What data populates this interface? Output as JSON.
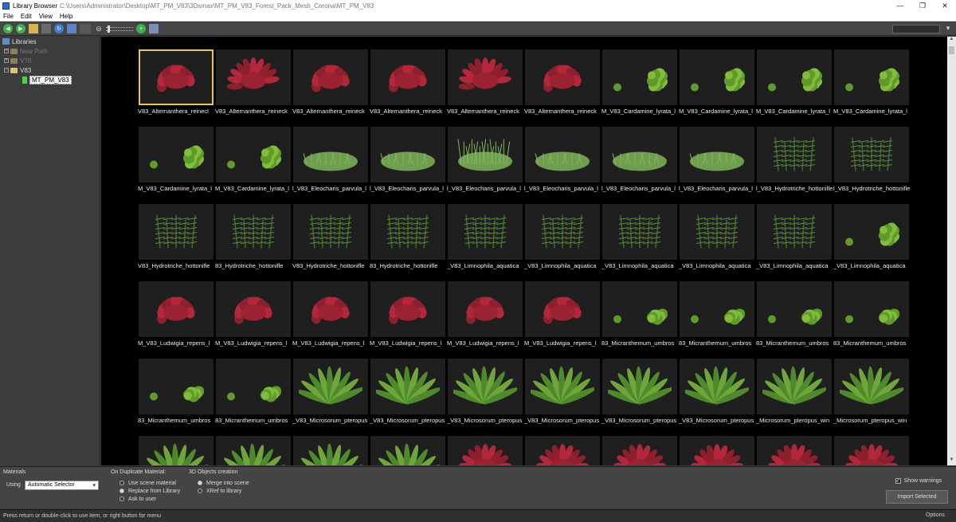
{
  "window": {
    "title": "Library Browser",
    "path": "C:\\Users\\Administrator\\Desktop\\MT_PM_V83\\3Dsmax\\MT_PM_V83_Forest_Pack_Mesh_Corona\\MT_PM_V83",
    "minimize": "—",
    "maximize": "❐",
    "close": "✕"
  },
  "menu": [
    "File",
    "Edit",
    "View",
    "Help"
  ],
  "tree": {
    "root": "Libraries",
    "items": [
      {
        "label": "New Path",
        "dim": true
      },
      {
        "label": "V78",
        "dim": true
      },
      {
        "label": "V83",
        "dim": false
      }
    ],
    "selected": "MT_PM_V83"
  },
  "colors": {
    "accent": "#e9c26b",
    "red_plant": "#b2273a",
    "green_plant": "#7fbd3a",
    "grass": "#6e9e4e"
  },
  "grid": {
    "rows": [
      [
        {
          "label": "V83_Alternanthera_reinecl",
          "kind": "red-bush"
        },
        {
          "label": "V83_Alternanthera_reineck",
          "kind": "red-spiky"
        },
        {
          "label": "V83_Alternanthera_reineck",
          "kind": "red-bush"
        },
        {
          "label": "V83_Alternanthera_reineck",
          "kind": "red-bush"
        },
        {
          "label": "V83_Alternanthera_reineck",
          "kind": "red-spiky"
        },
        {
          "label": "V83_Alternanthera_reineck",
          "kind": "red-bush"
        },
        {
          "label": "M_V83_Cardamine_lyrata_l",
          "kind": "green-leafy"
        },
        {
          "label": "M_V83_Cardamine_lyrata_l",
          "kind": "green-leafy"
        },
        {
          "label": "M_V83_Cardamine_lyrata_l",
          "kind": "green-leafy"
        },
        {
          "label": "M_V83_Cardamine_lyrata_l",
          "kind": "green-leafy"
        }
      ],
      [
        {
          "label": "M_V83_Cardamine_lyrata_l",
          "kind": "green-leafy"
        },
        {
          "label": "M_V83_Cardamine_lyrata_l",
          "kind": "green-leafy"
        },
        {
          "label": "l_V83_Eleocharis_parvula_l",
          "kind": "grass-mat"
        },
        {
          "label": "l_V83_Eleocharis_parvula_l",
          "kind": "grass-mat"
        },
        {
          "label": "l_V83_Eleocharis_parvula_l",
          "kind": "grass-tall"
        },
        {
          "label": "l_V83_Eleocharis_parvula_l",
          "kind": "grass-mat"
        },
        {
          "label": "l_V83_Eleocharis_parvula_l",
          "kind": "grass-mat"
        },
        {
          "label": "l_V83_Eleocharis_parvula_l",
          "kind": "grass-mat"
        },
        {
          "label": "l_V83_Hydrotriche_hottonifle",
          "kind": "stem-plant"
        },
        {
          "label": "l_V83_Hydrotriche_hottonifle",
          "kind": "stem-plant"
        }
      ],
      [
        {
          "label": "V83_Hydrotriche_hottonifle",
          "kind": "stem-plant"
        },
        {
          "label": "83_Hydrotriche_hottonifle",
          "kind": "stem-plant"
        },
        {
          "label": "V83_Hydrotriche_hottonifle",
          "kind": "stem-plant"
        },
        {
          "label": "83_Hydrotriche_hottonifle",
          "kind": "stem-plant"
        },
        {
          "label": "_V83_Limnophila_aquatica",
          "kind": "stem-plant"
        },
        {
          "label": "_V83_Limnophila_aquatica",
          "kind": "stem-plant"
        },
        {
          "label": "_V83_Limnophila_aquatica",
          "kind": "stem-plant"
        },
        {
          "label": "_V83_Limnophila_aquatica",
          "kind": "stem-plant"
        },
        {
          "label": "_V83_Limnophila_aquatica",
          "kind": "stem-plant"
        },
        {
          "label": "_V83_Limnophila_aquatica",
          "kind": "green-leafy"
        }
      ],
      [
        {
          "label": "M_V83_Ludwigia_repens_l",
          "kind": "red-bush"
        },
        {
          "label": "M_V83_Ludwigia_repens_l",
          "kind": "red-bush"
        },
        {
          "label": "M_V83_Ludwigia_repens_l",
          "kind": "red-bush"
        },
        {
          "label": "M_V83_Ludwigia_repens_l",
          "kind": "red-bush"
        },
        {
          "label": "M_V83_Ludwigia_repens_l",
          "kind": "red-bush"
        },
        {
          "label": "M_V83_Ludwigia_repens_l",
          "kind": "red-bush"
        },
        {
          "label": "83_Micranthemum_umbros",
          "kind": "carpet"
        },
        {
          "label": "83_Micranthemum_umbros",
          "kind": "carpet"
        },
        {
          "label": "83_Micranthemum_umbros",
          "kind": "carpet"
        },
        {
          "label": "83_Micranthemum_umbros",
          "kind": "carpet"
        }
      ],
      [
        {
          "label": "83_Micranthemum_umbros",
          "kind": "carpet"
        },
        {
          "label": "83_Micranthemum_umbros",
          "kind": "carpet"
        },
        {
          "label": "_V83_Microsorum_pteropus",
          "kind": "fern"
        },
        {
          "label": "_V83_Microsorum_pteropus",
          "kind": "fern"
        },
        {
          "label": "_V83_Microsorum_pteropus",
          "kind": "fern"
        },
        {
          "label": "_V83_Microsorum_pteropus",
          "kind": "fern"
        },
        {
          "label": "_V83_Microsorum_pteropus",
          "kind": "fern"
        },
        {
          "label": "_V83_Microsorum_pteropus",
          "kind": "fern"
        },
        {
          "label": "_Microsorum_pteropus_win",
          "kind": "fern"
        },
        {
          "label": "_Microsorum_pteropus_win",
          "kind": "fern"
        }
      ],
      [
        {
          "label": "",
          "kind": "fern"
        },
        {
          "label": "",
          "kind": "fern"
        },
        {
          "label": "",
          "kind": "fern"
        },
        {
          "label": "",
          "kind": "fern"
        },
        {
          "label": "",
          "kind": "red-spiky"
        },
        {
          "label": "",
          "kind": "red-spiky"
        },
        {
          "label": "",
          "kind": "red-spiky"
        },
        {
          "label": "",
          "kind": "red-spiky"
        },
        {
          "label": "",
          "kind": "red-spiky"
        },
        {
          "label": "",
          "kind": "red-spiky"
        }
      ]
    ]
  },
  "bottom": {
    "materials_title": "Materials",
    "using_label": "Using",
    "using_value": "Automatic Selector",
    "dup_title": "On Duplicate Material:",
    "dup_options": [
      {
        "label": "Use scene material",
        "on": false
      },
      {
        "label": "Replace from Library",
        "on": true
      },
      {
        "label": "Ask to user",
        "on": false
      }
    ],
    "objects_title": "3D Objects creation",
    "obj_options": [
      {
        "label": "Merge into scene",
        "on": true
      },
      {
        "label": "XRef to library",
        "on": false
      }
    ],
    "show_warnings": "Show warnings",
    "import_button": "Import Selected"
  },
  "status": {
    "hint": "Press return or double-click to use item, or right button for menu",
    "options": "Options"
  }
}
